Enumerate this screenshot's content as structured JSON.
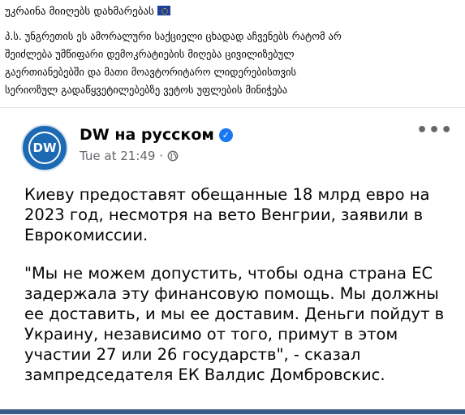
{
  "header": {
    "title": "უკრაინა მიიღებს დახმარებას",
    "body": "პ.ს. უნგრეთის ეს ამორალური საქციელი ცხადად აჩვენებს რატომ არ\nშეიძლება უმწიფარი დემოკრატიების მიღება ცივილიზებულ\nგაერთიანებებში და მათი მოავტორიტარო ლიდერებისთვის\nსერიოზულ გადაწყვეტილებებზე ვეტოს უფლების მინიჭება",
    "flag_icon": "eu-flag-icon"
  },
  "post": {
    "avatar_text": "DW",
    "page_name": "DW на русском",
    "timestamp": "Tue at 21:49",
    "separator": " · ",
    "paragraphs": [
      "Киеву предоставят обещанные 18 млрд евро на 2023 год, несмотря на вето Венгрии, заявили в Еврокомиссии.",
      "\"Мы не можем допустить, чтобы одна страна ЕС задержала эту финансовую помощь. Мы должны ее доставить, и мы ее доставим. Деньги пойдут в Украину, независимо от того, примут в этом участии 27 или 26 государств\", - сказал зампредседателя ЕК Валдис Домбровскис."
    ],
    "colors": {
      "avatar": "#1c6ab3",
      "verified": "#1877f2",
      "meta": "#65676b"
    }
  }
}
